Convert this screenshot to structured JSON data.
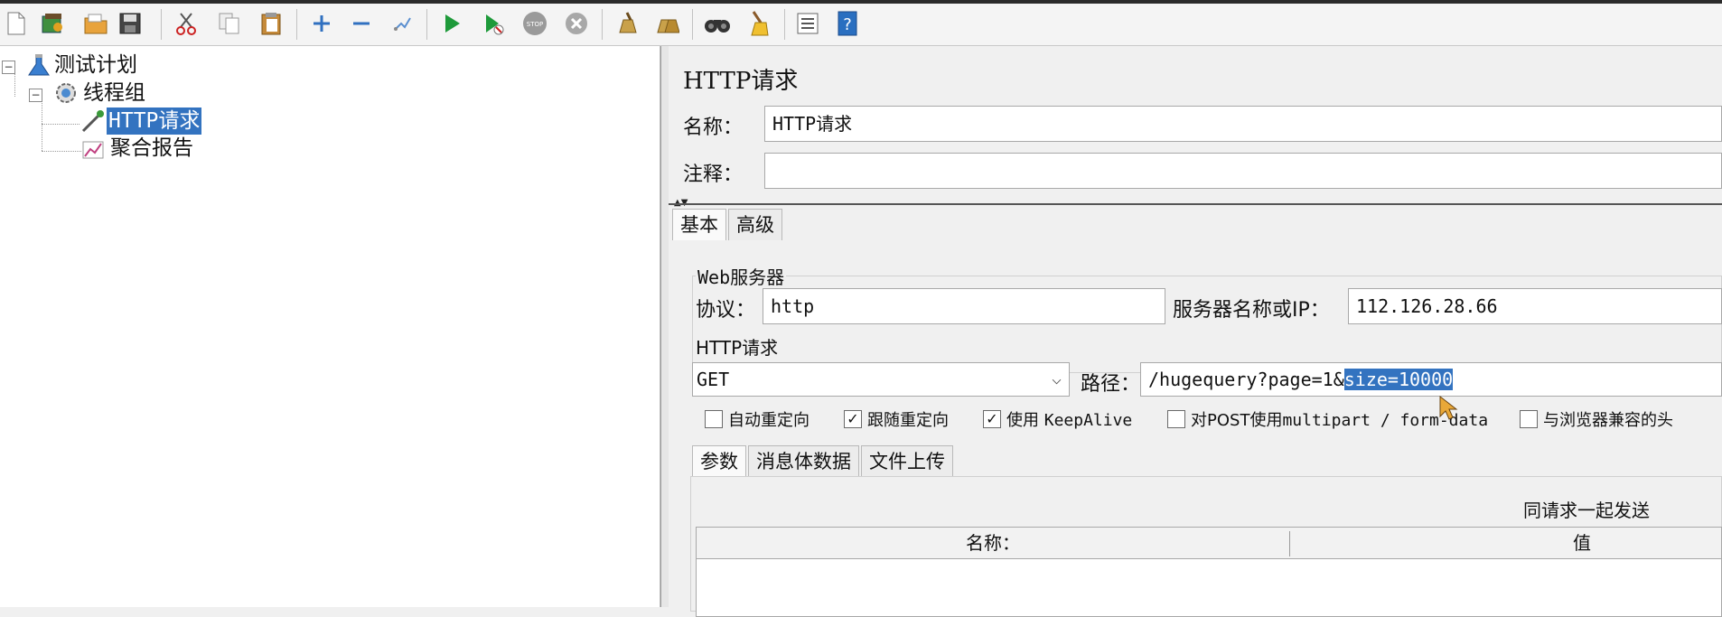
{
  "toolbar": {
    "buttons": [
      {
        "name": "new-icon"
      },
      {
        "name": "templates-icon"
      },
      {
        "name": "open-icon"
      },
      {
        "name": "save-icon"
      },
      {
        "name": "cut-icon"
      },
      {
        "name": "copy-icon"
      },
      {
        "name": "paste-icon"
      },
      {
        "name": "expand-icon"
      },
      {
        "name": "collapse-icon"
      },
      {
        "name": "toggle-icon"
      },
      {
        "name": "start-icon"
      },
      {
        "name": "start-no-pauses-icon"
      },
      {
        "name": "stop-icon"
      },
      {
        "name": "shutdown-icon"
      },
      {
        "name": "clear-icon"
      },
      {
        "name": "clear-all-icon"
      },
      {
        "name": "search-icon"
      },
      {
        "name": "reset-search-icon"
      },
      {
        "name": "function-helper-icon"
      },
      {
        "name": "help-icon"
      }
    ]
  },
  "tree": {
    "test_plan": "测试计划",
    "thread_group": "线程组",
    "http_request": "HTTP请求",
    "aggregate_report": "聚合报告"
  },
  "editor": {
    "title": "HTTP请求",
    "name_label": "名称：",
    "name_value": "HTTP请求",
    "comment_label": "注释：",
    "comment_value": "",
    "tabs": [
      "基本",
      "高级"
    ],
    "web_server": {
      "title": "Web服务器",
      "protocol_label": "协议：",
      "protocol_value": "http",
      "server_label": "服务器名称或IP：",
      "server_value": "112.126.28.66"
    },
    "http_request": {
      "title": "HTTP请求",
      "method": "GET",
      "path_label": "路径：",
      "path_value_plain": "/hugequery?page=1&",
      "path_value_selected": "size=10000"
    },
    "options": [
      {
        "label": "自动重定向",
        "mono": "",
        "checked": false
      },
      {
        "label": "跟随重定向",
        "mono": "",
        "checked": true
      },
      {
        "label": "使用 ",
        "mono": "KeepAlive",
        "checked": true
      },
      {
        "label": "对POST使用",
        "mono": "multipart / form-data",
        "checked": false
      },
      {
        "label": "与浏览器兼容的头",
        "mono": "",
        "checked": false
      }
    ],
    "sub_tabs": [
      "参数",
      "消息体数据",
      "文件上传"
    ],
    "send_with_request": "同请求一起发送",
    "table_headers": [
      "名称：",
      "值"
    ]
  },
  "colors": {
    "selection": "#3373c0",
    "background": "#f0f0f0"
  }
}
